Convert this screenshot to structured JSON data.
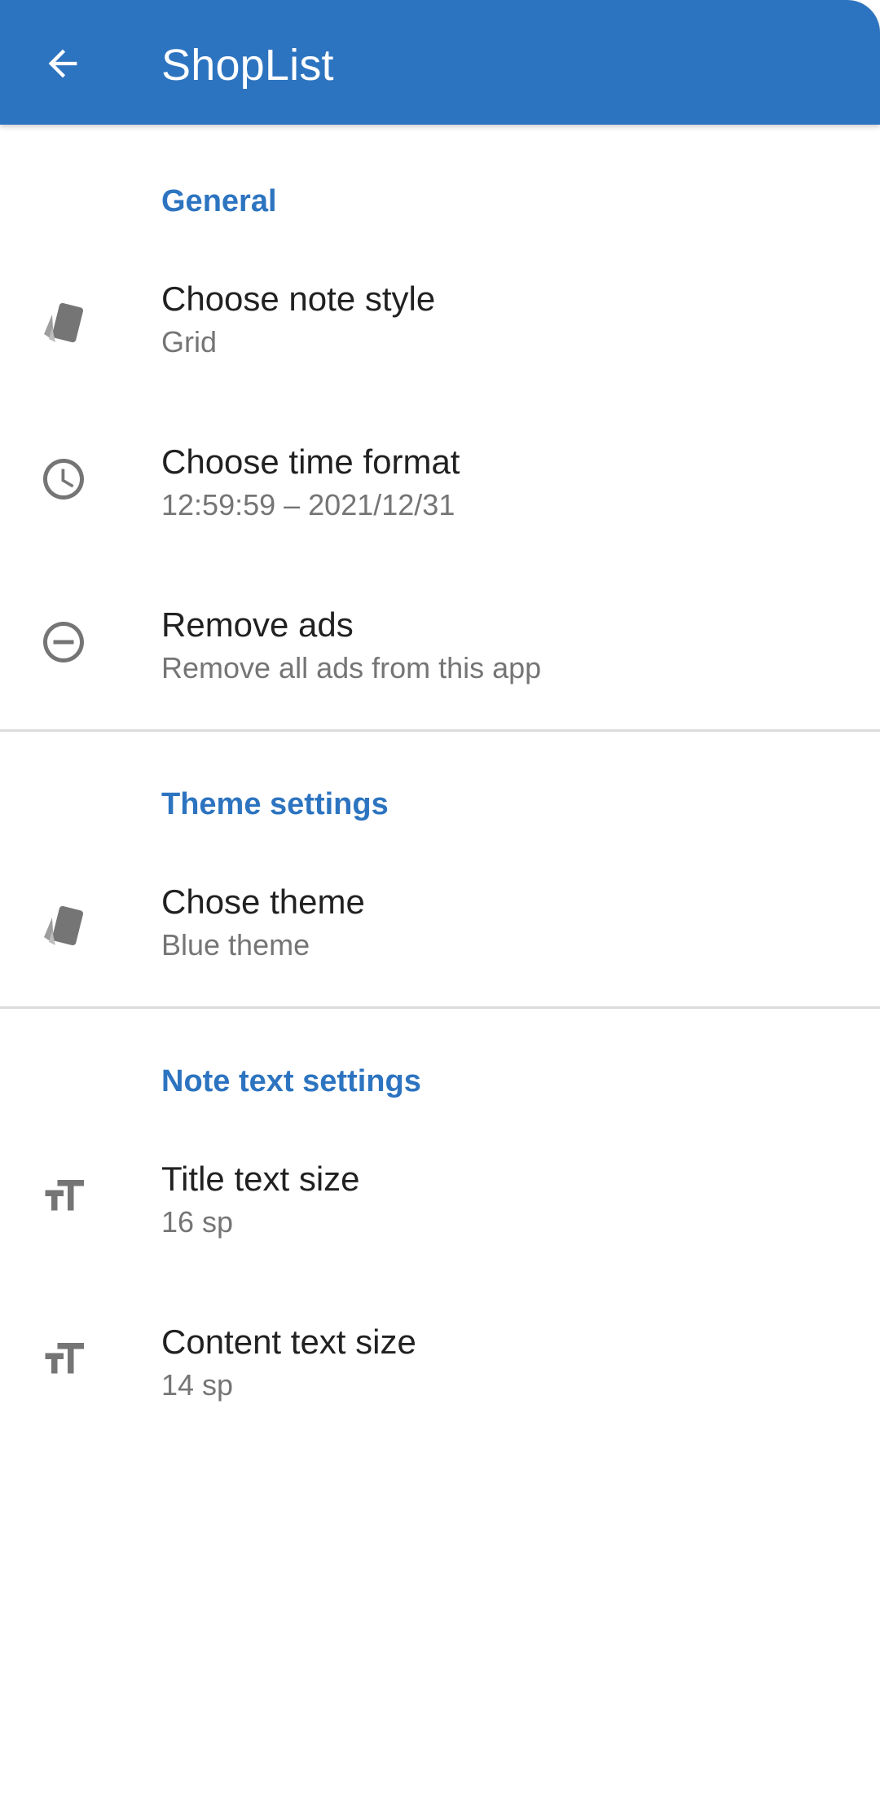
{
  "appbar": {
    "title": "ShopList",
    "back_icon": "arrow-back-icon",
    "color": "#2d74c0"
  },
  "categories": {
    "general": "General",
    "theme": "Theme settings",
    "note_text": "Note text settings"
  },
  "prefs": {
    "note_style": {
      "title": "Choose note style",
      "summary": "Grid",
      "icon": "palette-cards-icon"
    },
    "time_format": {
      "title": "Choose time format",
      "summary": "12:59:59 – 2021/12/31",
      "icon": "clock-icon"
    },
    "remove_ads": {
      "title": "Remove ads",
      "summary": "Remove all ads from this app",
      "icon": "remove-circle-icon"
    },
    "theme": {
      "title": "Chose theme",
      "summary": "Blue theme",
      "icon": "palette-cards-icon"
    },
    "title_size": {
      "title": "Title text size",
      "summary": "16 sp",
      "icon": "text-size-icon"
    },
    "content_size": {
      "title": "Content text size",
      "summary": "14 sp",
      "icon": "text-size-icon"
    }
  },
  "colors": {
    "accent": "#2d74c0",
    "icon": "#757575",
    "primary_text": "#212121",
    "secondary_text": "#757575"
  }
}
